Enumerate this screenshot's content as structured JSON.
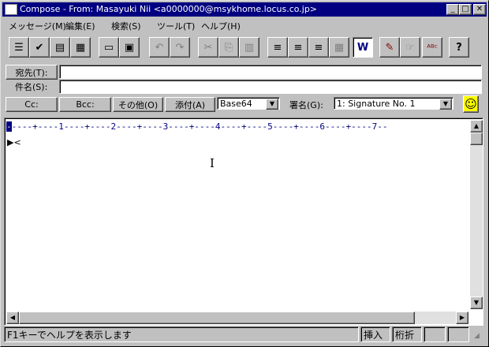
{
  "window": {
    "title": "Compose - From: Masayuki Nii <a0000000@msykhome.locus.co.jp>",
    "controls": {
      "minimize": "_",
      "maximize": "□",
      "close": "✕"
    }
  },
  "menubar": [
    "メッセージ(M)",
    "編集(E)",
    "検索(S)",
    "ツール(T)",
    "ヘルプ(H)"
  ],
  "toolbar": {
    "buttons": [
      {
        "icon": "address-book-icon",
        "glyph": "☰"
      },
      {
        "icon": "check-names-icon",
        "glyph": "✔"
      },
      {
        "icon": "attach-file-icon",
        "glyph": "▤"
      },
      {
        "icon": "calendar-icon",
        "glyph": "▦"
      },
      {
        "icon": "page-icon",
        "glyph": "▭"
      },
      {
        "icon": "save-icon",
        "glyph": "▣"
      },
      {
        "icon": "undo-icon",
        "glyph": "↶"
      },
      {
        "icon": "redo-icon",
        "glyph": "↷"
      },
      {
        "icon": "cut-icon",
        "glyph": "✂"
      },
      {
        "icon": "copy-icon",
        "glyph": "⎘"
      },
      {
        "icon": "paste-icon",
        "glyph": "▥"
      },
      {
        "icon": "align-center-icon",
        "glyph": "≡"
      },
      {
        "icon": "align-left-icon",
        "glyph": "≡"
      },
      {
        "icon": "align-right-icon",
        "glyph": "≡"
      },
      {
        "icon": "grid-icon",
        "glyph": "▦"
      },
      {
        "icon": "word-wrap-icon",
        "glyph": "W"
      },
      {
        "icon": "pen-icon",
        "glyph": "✎"
      },
      {
        "icon": "pointer-hand-icon",
        "glyph": "☞"
      },
      {
        "icon": "spell-check-icon",
        "glyph": "ᴬᴮᶜ"
      },
      {
        "icon": "help-pointer-icon",
        "glyph": "?"
      }
    ]
  },
  "fields": {
    "to_label": "宛先(T):",
    "to_value": "",
    "subject_label": "件名(S):",
    "subject_value": "",
    "cc_label": "Cc:",
    "bcc_label": "Bcc:",
    "other_label": "その他(O)",
    "attach_label": "添付(A)",
    "encoding_value": "Base64",
    "signature_label": "署名(G):",
    "signature_value": "1: Signature No. 1",
    "smiley": "☺"
  },
  "editor": {
    "ruler": "----+----1----+----2----+----3----+----4----+----5----+----6----+----7--",
    "ruler_cursor": "-",
    "caret": "▶<"
  },
  "statusbar": {
    "message": "F1キーでヘルプを表示します",
    "insert": "挿入",
    "wrap": "桁折"
  },
  "colors": {
    "titlebar": "#000080",
    "ruler_text": "#000080",
    "face": "#c0c0c0"
  }
}
